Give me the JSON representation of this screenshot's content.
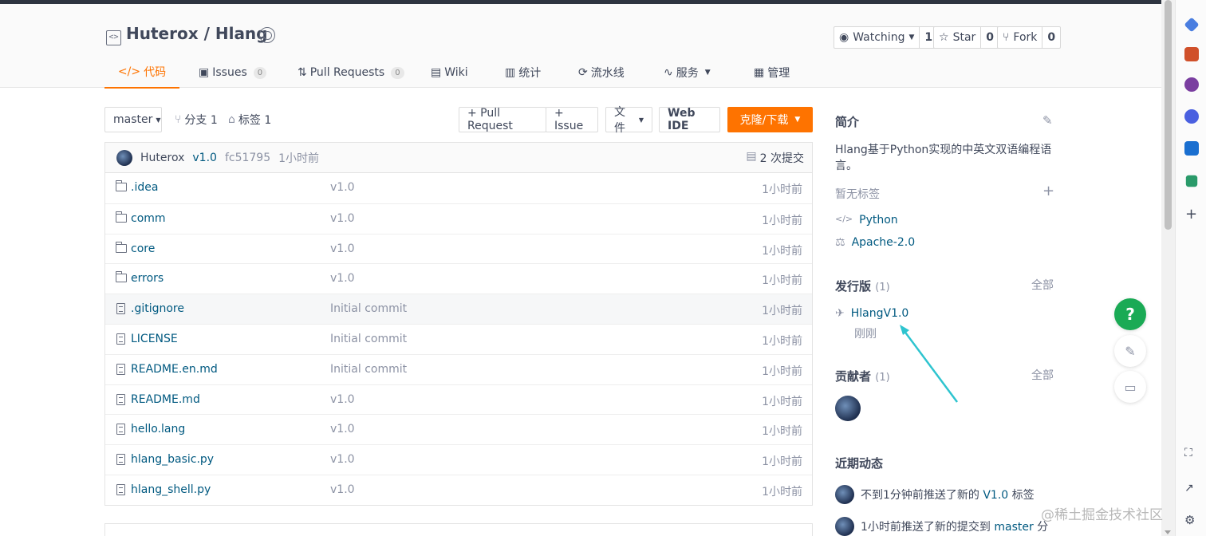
{
  "repo": {
    "owner": "Huterox",
    "sep": " / ",
    "name": "Hlang"
  },
  "header_buttons": [
    {
      "label": "Watching",
      "count": "1"
    },
    {
      "label": "Star",
      "count": "0"
    },
    {
      "label": "Fork",
      "count": "0"
    }
  ],
  "tabs": [
    {
      "label": "代码",
      "count": ""
    },
    {
      "label": "Issues",
      "count": "0"
    },
    {
      "label": "Pull Requests",
      "count": "0"
    },
    {
      "label": "Wiki",
      "count": ""
    },
    {
      "label": "统计",
      "count": ""
    },
    {
      "label": "流水线",
      "count": ""
    },
    {
      "label": "服务",
      "count": ""
    },
    {
      "label": "管理",
      "count": ""
    }
  ],
  "toolbar": {
    "branch": "master",
    "branches": "分支 1",
    "tags": "标签 1",
    "pull_request": "+ Pull Request",
    "issue": "+ Issue",
    "file": "文件",
    "web_ide": "Web IDE",
    "clone": "克隆/下载"
  },
  "commit": {
    "author": "Huterox",
    "message": "v1.0",
    "hash": "fc51795",
    "time": "1小时前",
    "count": "2 次提交"
  },
  "files": [
    {
      "type": "folder",
      "name": ".idea",
      "msg": "v1.0",
      "time": "1小时前"
    },
    {
      "type": "folder",
      "name": "comm",
      "msg": "v1.0",
      "time": "1小时前"
    },
    {
      "type": "folder",
      "name": "core",
      "msg": "v1.0",
      "time": "1小时前"
    },
    {
      "type": "folder",
      "name": "errors",
      "msg": "v1.0",
      "time": "1小时前"
    },
    {
      "type": "file",
      "name": ".gitignore",
      "msg": "Initial commit",
      "time": "1小时前"
    },
    {
      "type": "file",
      "name": "LICENSE",
      "msg": "Initial commit",
      "time": "1小时前"
    },
    {
      "type": "file",
      "name": "README.en.md",
      "msg": "Initial commit",
      "time": "1小时前"
    },
    {
      "type": "file",
      "name": "README.md",
      "msg": "v1.0",
      "time": "1小时前"
    },
    {
      "type": "file",
      "name": "hello.lang",
      "msg": "v1.0",
      "time": "1小时前"
    },
    {
      "type": "file",
      "name": "hlang_basic.py",
      "msg": "v1.0",
      "time": "1小时前"
    },
    {
      "type": "file",
      "name": "hlang_shell.py",
      "msg": "v1.0",
      "time": "1小时前"
    }
  ],
  "sidebar": {
    "intro_title": "简介",
    "description_line1": "Hlang基于Python实现的中英文双语编程语",
    "description_line2": "言。",
    "no_tags": "暂无标签",
    "language": "Python",
    "license": "Apache-2.0",
    "releases_title": "发行版",
    "releases_count": "(1)",
    "all_label": "全部",
    "release_name": "HlangV1.0",
    "release_time": "刚刚",
    "contributors_title": "贡献者",
    "contributors_count": "(1)",
    "activity_title": "近期动态",
    "activity": [
      {
        "text": "不到1分钟前推送了新的 ",
        "link": "V1.0",
        "suffix": " 标签"
      },
      {
        "text": "1小时前推送了新的提交到 ",
        "link": "master",
        "suffix": " 分"
      }
    ]
  },
  "float_buttons": {
    "help": "?"
  },
  "watermark": "@稀土掘金技术社区",
  "colors": {
    "accent": "#fe7300",
    "link": "#005980",
    "help_green": "#1aaa55",
    "arrow": "#2ec4cf"
  }
}
